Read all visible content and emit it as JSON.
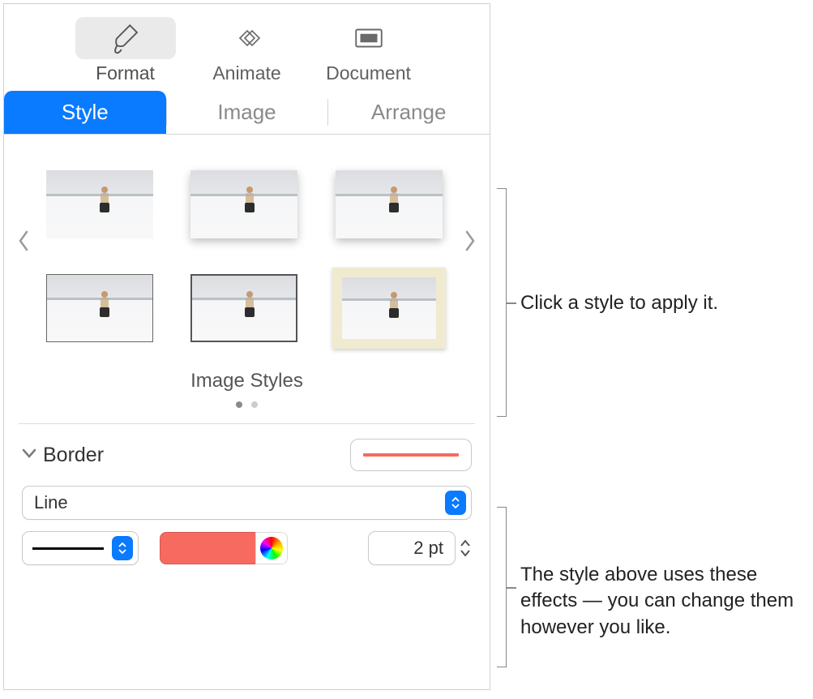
{
  "toolbar": {
    "format": "Format",
    "animate": "Animate",
    "document": "Document"
  },
  "tabs": {
    "style": "Style",
    "image": "Image",
    "arrange": "Arrange"
  },
  "styles": {
    "label": "Image Styles"
  },
  "border": {
    "title": "Border",
    "type": "Line",
    "color": "#f76a60",
    "width_display": "2 pt"
  },
  "callouts": {
    "c1": "Click a style to apply it.",
    "c2": "The style above uses these effects — you can change them however you like."
  }
}
